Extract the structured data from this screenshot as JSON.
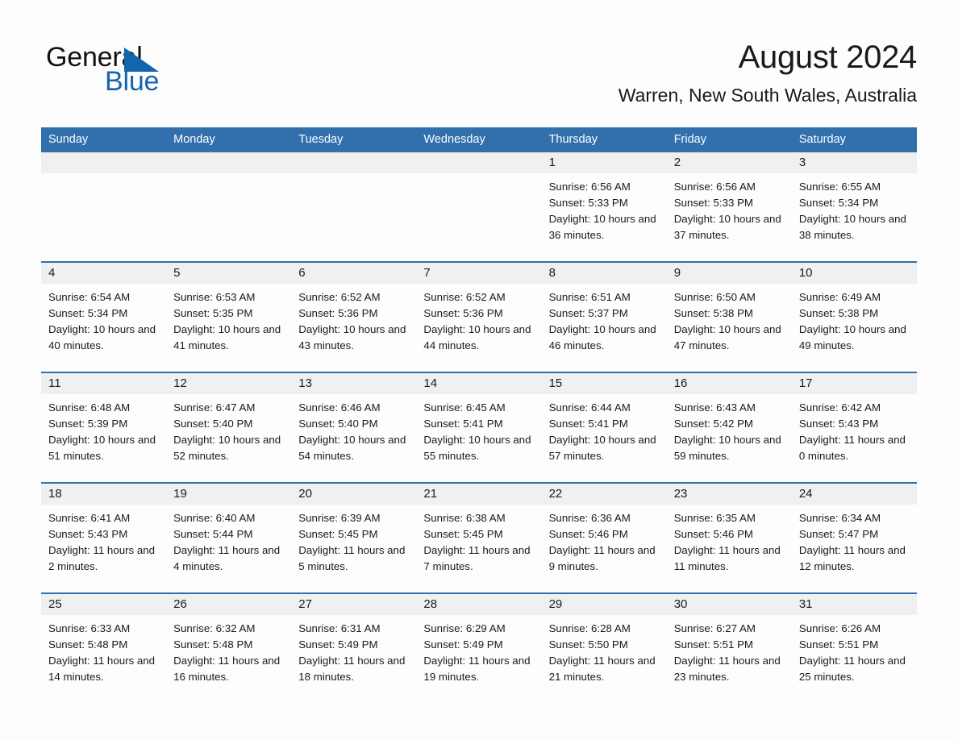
{
  "brand": {
    "name_part1": "General",
    "name_part2": "Blue",
    "accent_color": "#1565b0",
    "triangle_color": "#1166ad"
  },
  "header": {
    "title": "August 2024",
    "subtitle": "Warren, New South Wales, Australia",
    "header_bg_color": "#3170ad",
    "day_band_color": "#f0f0f0"
  },
  "weekdays": [
    "Sunday",
    "Monday",
    "Tuesday",
    "Wednesday",
    "Thursday",
    "Friday",
    "Saturday"
  ],
  "weeks": [
    [
      {
        "day": "",
        "sunrise": "",
        "sunset": "",
        "daylight": "",
        "empty": true
      },
      {
        "day": "",
        "sunrise": "",
        "sunset": "",
        "daylight": "",
        "empty": true
      },
      {
        "day": "",
        "sunrise": "",
        "sunset": "",
        "daylight": "",
        "empty": true
      },
      {
        "day": "",
        "sunrise": "",
        "sunset": "",
        "daylight": "",
        "empty": true
      },
      {
        "day": "1",
        "sunrise": "Sunrise: 6:56 AM",
        "sunset": "Sunset: 5:33 PM",
        "daylight": "Daylight: 10 hours and 36 minutes."
      },
      {
        "day": "2",
        "sunrise": "Sunrise: 6:56 AM",
        "sunset": "Sunset: 5:33 PM",
        "daylight": "Daylight: 10 hours and 37 minutes."
      },
      {
        "day": "3",
        "sunrise": "Sunrise: 6:55 AM",
        "sunset": "Sunset: 5:34 PM",
        "daylight": "Daylight: 10 hours and 38 minutes."
      }
    ],
    [
      {
        "day": "4",
        "sunrise": "Sunrise: 6:54 AM",
        "sunset": "Sunset: 5:34 PM",
        "daylight": "Daylight: 10 hours and 40 minutes."
      },
      {
        "day": "5",
        "sunrise": "Sunrise: 6:53 AM",
        "sunset": "Sunset: 5:35 PM",
        "daylight": "Daylight: 10 hours and 41 minutes."
      },
      {
        "day": "6",
        "sunrise": "Sunrise: 6:52 AM",
        "sunset": "Sunset: 5:36 PM",
        "daylight": "Daylight: 10 hours and 43 minutes."
      },
      {
        "day": "7",
        "sunrise": "Sunrise: 6:52 AM",
        "sunset": "Sunset: 5:36 PM",
        "daylight": "Daylight: 10 hours and 44 minutes."
      },
      {
        "day": "8",
        "sunrise": "Sunrise: 6:51 AM",
        "sunset": "Sunset: 5:37 PM",
        "daylight": "Daylight: 10 hours and 46 minutes."
      },
      {
        "day": "9",
        "sunrise": "Sunrise: 6:50 AM",
        "sunset": "Sunset: 5:38 PM",
        "daylight": "Daylight: 10 hours and 47 minutes."
      },
      {
        "day": "10",
        "sunrise": "Sunrise: 6:49 AM",
        "sunset": "Sunset: 5:38 PM",
        "daylight": "Daylight: 10 hours and 49 minutes."
      }
    ],
    [
      {
        "day": "11",
        "sunrise": "Sunrise: 6:48 AM",
        "sunset": "Sunset: 5:39 PM",
        "daylight": "Daylight: 10 hours and 51 minutes."
      },
      {
        "day": "12",
        "sunrise": "Sunrise: 6:47 AM",
        "sunset": "Sunset: 5:40 PM",
        "daylight": "Daylight: 10 hours and 52 minutes."
      },
      {
        "day": "13",
        "sunrise": "Sunrise: 6:46 AM",
        "sunset": "Sunset: 5:40 PM",
        "daylight": "Daylight: 10 hours and 54 minutes."
      },
      {
        "day": "14",
        "sunrise": "Sunrise: 6:45 AM",
        "sunset": "Sunset: 5:41 PM",
        "daylight": "Daylight: 10 hours and 55 minutes."
      },
      {
        "day": "15",
        "sunrise": "Sunrise: 6:44 AM",
        "sunset": "Sunset: 5:41 PM",
        "daylight": "Daylight: 10 hours and 57 minutes."
      },
      {
        "day": "16",
        "sunrise": "Sunrise: 6:43 AM",
        "sunset": "Sunset: 5:42 PM",
        "daylight": "Daylight: 10 hours and 59 minutes."
      },
      {
        "day": "17",
        "sunrise": "Sunrise: 6:42 AM",
        "sunset": "Sunset: 5:43 PM",
        "daylight": "Daylight: 11 hours and 0 minutes."
      }
    ],
    [
      {
        "day": "18",
        "sunrise": "Sunrise: 6:41 AM",
        "sunset": "Sunset: 5:43 PM",
        "daylight": "Daylight: 11 hours and 2 minutes."
      },
      {
        "day": "19",
        "sunrise": "Sunrise: 6:40 AM",
        "sunset": "Sunset: 5:44 PM",
        "daylight": "Daylight: 11 hours and 4 minutes."
      },
      {
        "day": "20",
        "sunrise": "Sunrise: 6:39 AM",
        "sunset": "Sunset: 5:45 PM",
        "daylight": "Daylight: 11 hours and 5 minutes."
      },
      {
        "day": "21",
        "sunrise": "Sunrise: 6:38 AM",
        "sunset": "Sunset: 5:45 PM",
        "daylight": "Daylight: 11 hours and 7 minutes."
      },
      {
        "day": "22",
        "sunrise": "Sunrise: 6:36 AM",
        "sunset": "Sunset: 5:46 PM",
        "daylight": "Daylight: 11 hours and 9 minutes."
      },
      {
        "day": "23",
        "sunrise": "Sunrise: 6:35 AM",
        "sunset": "Sunset: 5:46 PM",
        "daylight": "Daylight: 11 hours and 11 minutes."
      },
      {
        "day": "24",
        "sunrise": "Sunrise: 6:34 AM",
        "sunset": "Sunset: 5:47 PM",
        "daylight": "Daylight: 11 hours and 12 minutes."
      }
    ],
    [
      {
        "day": "25",
        "sunrise": "Sunrise: 6:33 AM",
        "sunset": "Sunset: 5:48 PM",
        "daylight": "Daylight: 11 hours and 14 minutes."
      },
      {
        "day": "26",
        "sunrise": "Sunrise: 6:32 AM",
        "sunset": "Sunset: 5:48 PM",
        "daylight": "Daylight: 11 hours and 16 minutes."
      },
      {
        "day": "27",
        "sunrise": "Sunrise: 6:31 AM",
        "sunset": "Sunset: 5:49 PM",
        "daylight": "Daylight: 11 hours and 18 minutes."
      },
      {
        "day": "28",
        "sunrise": "Sunrise: 6:29 AM",
        "sunset": "Sunset: 5:49 PM",
        "daylight": "Daylight: 11 hours and 19 minutes."
      },
      {
        "day": "29",
        "sunrise": "Sunrise: 6:28 AM",
        "sunset": "Sunset: 5:50 PM",
        "daylight": "Daylight: 11 hours and 21 minutes."
      },
      {
        "day": "30",
        "sunrise": "Sunrise: 6:27 AM",
        "sunset": "Sunset: 5:51 PM",
        "daylight": "Daylight: 11 hours and 23 minutes."
      },
      {
        "day": "31",
        "sunrise": "Sunrise: 6:26 AM",
        "sunset": "Sunset: 5:51 PM",
        "daylight": "Daylight: 11 hours and 25 minutes."
      }
    ]
  ]
}
